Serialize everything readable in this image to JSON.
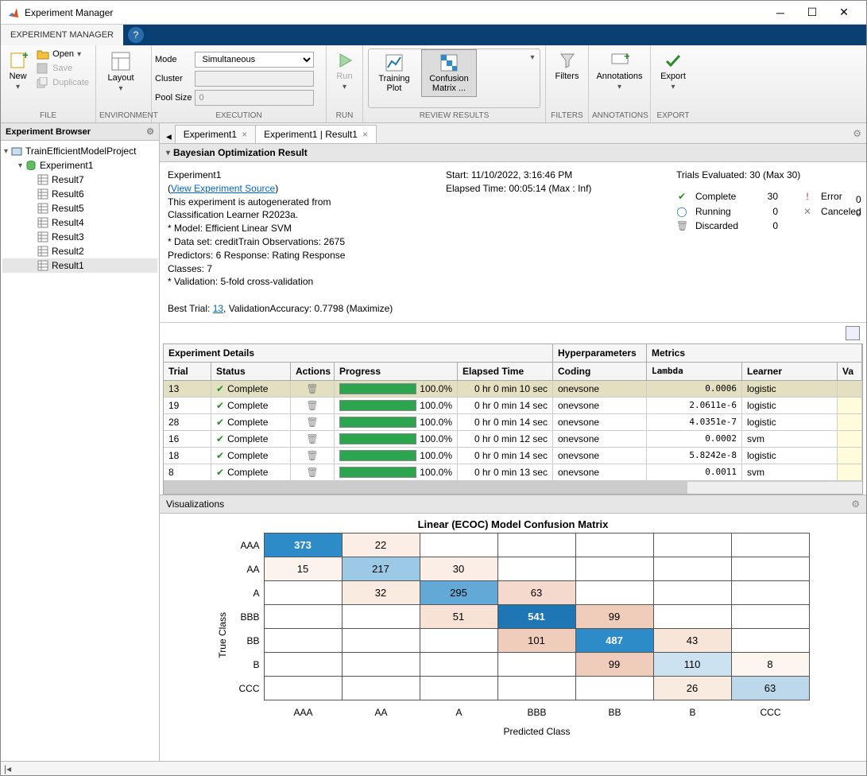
{
  "window": {
    "title": "Experiment Manager"
  },
  "ribbontab": "EXPERIMENT MANAGER",
  "ribbon": {
    "file": {
      "label": "FILE",
      "new": "New",
      "open": "Open",
      "save": "Save",
      "duplicate": "Duplicate"
    },
    "env": {
      "label": "ENVIRONMENT",
      "layout": "Layout"
    },
    "exec": {
      "label": "EXECUTION",
      "mode_l": "Mode",
      "mode_v": "Simultaneous",
      "cluster_l": "Cluster",
      "cluster_v": "",
      "pool_l": "Pool Size",
      "pool_v": "0"
    },
    "run": {
      "label": "RUN",
      "run": "Run"
    },
    "review": {
      "label": "REVIEW RESULTS",
      "training_plot": "Training Plot",
      "confusion_l1": "Confusion",
      "confusion_l2": "Matrix ..."
    },
    "filters": {
      "label": "FILTERS",
      "btn": "Filters"
    },
    "annot": {
      "label": "ANNOTATIONS",
      "btn": "Annotations"
    },
    "export": {
      "label": "EXPORT",
      "btn": "Export"
    }
  },
  "browser": {
    "title": "Experiment Browser",
    "project": "TrainEfficientModelProject",
    "experiment": "Experiment1",
    "results": [
      "Result7",
      "Result6",
      "Result5",
      "Result4",
      "Result3",
      "Result2",
      "Result1"
    ],
    "selected": "Result1"
  },
  "tabs": {
    "t1": "Experiment1",
    "t2": "Experiment1 | Result1"
  },
  "result": {
    "header": "Bayesian Optimization Result",
    "name": "Experiment1",
    "view_source": "View Experiment Source",
    "desc1": "This experiment is autogenerated from",
    "desc2": "Classification Learner R2023a.",
    "model": "* Model: Efficient Linear SVM",
    "dataset": "* Data set: creditTrain   Observations: 2675",
    "predictors": "Predictors: 6   Response: Rating   Response",
    "classes": "Classes: 7",
    "validation": "* Validation: 5-fold cross-validation",
    "best_pre": "Best Trial: ",
    "best_trial": "13",
    "best_post": ", ValidationAccuracy: 0.7798 (Maximize)",
    "start": "Start: 11/10/2022, 3:16:46 PM",
    "elapsed": "Elapsed Time: 00:05:14 (Max : Inf)",
    "trials_eval": "Trials Evaluated: 30 (Max 30)",
    "statuses": {
      "complete_l": "Complete",
      "complete_n": "30",
      "running_l": "Running",
      "running_n": "0",
      "discarded_l": "Discarded",
      "discarded_n": "0",
      "error_l": "Error",
      "error_n": "0",
      "canceled_l": "Canceled",
      "canceled_n": "0"
    }
  },
  "table": {
    "groups": {
      "details": "Experiment Details",
      "hyper": "Hyperparameters",
      "metrics": "Metrics"
    },
    "cols": {
      "trial": "Trial",
      "status": "Status",
      "actions": "Actions",
      "progress": "Progress",
      "elapsed": "Elapsed Time",
      "coding": "Coding",
      "lambda": "Lambda",
      "learner": "Learner",
      "va": "Va"
    },
    "rows": [
      {
        "trial": "13",
        "status": "Complete",
        "progress": "100.0%",
        "elapsed": "0 hr 0 min 10 sec",
        "coding": "onevsone",
        "lambda": "0.0006",
        "learner": "logistic",
        "hl": true
      },
      {
        "trial": "19",
        "status": "Complete",
        "progress": "100.0%",
        "elapsed": "0 hr 0 min 14 sec",
        "coding": "onevsone",
        "lambda": "2.0611e-6",
        "learner": "logistic"
      },
      {
        "trial": "28",
        "status": "Complete",
        "progress": "100.0%",
        "elapsed": "0 hr 0 min 14 sec",
        "coding": "onevsone",
        "lambda": "4.0351e-7",
        "learner": "logistic"
      },
      {
        "trial": "16",
        "status": "Complete",
        "progress": "100.0%",
        "elapsed": "0 hr 0 min 12 sec",
        "coding": "onevsone",
        "lambda": "0.0002",
        "learner": "svm"
      },
      {
        "trial": "18",
        "status": "Complete",
        "progress": "100.0%",
        "elapsed": "0 hr 0 min 14 sec",
        "coding": "onevsone",
        "lambda": "5.8242e-8",
        "learner": "logistic"
      },
      {
        "trial": "8",
        "status": "Complete",
        "progress": "100.0%",
        "elapsed": "0 hr 0 min 13 sec",
        "coding": "onevsone",
        "lambda": "0.0011",
        "learner": "svm"
      }
    ]
  },
  "viz": {
    "title": "Visualizations"
  },
  "chart_data": {
    "type": "heatmap",
    "title": "Linear (ECOC) Model Confusion Matrix",
    "xlabel": "Predicted Class",
    "ylabel": "True Class",
    "categories": [
      "AAA",
      "AA",
      "A",
      "BBB",
      "BB",
      "B",
      "CCC"
    ],
    "matrix": [
      [
        373,
        22,
        null,
        null,
        null,
        null,
        null
      ],
      [
        15,
        217,
        30,
        null,
        null,
        null,
        null
      ],
      [
        null,
        32,
        295,
        63,
        null,
        null,
        null
      ],
      [
        null,
        null,
        51,
        541,
        99,
        null,
        null
      ],
      [
        null,
        null,
        null,
        101,
        487,
        43,
        null
      ],
      [
        null,
        null,
        null,
        null,
        99,
        110,
        8
      ],
      [
        null,
        null,
        null,
        null,
        null,
        26,
        63
      ]
    ],
    "cell_colors": [
      [
        "#2d8bc8",
        "#fbeee6",
        "",
        "",
        "",
        "",
        ""
      ],
      [
        "#fcf3ed",
        "#9cc9e6",
        "#fbeee6",
        "",
        "",
        "",
        ""
      ],
      [
        "",
        "#faebe0",
        "#63a9d8",
        "#f4d9cc",
        "",
        "",
        ""
      ],
      [
        "",
        "",
        "#f7e2d5",
        "#1e77b4",
        "#f0ccba",
        "",
        ""
      ],
      [
        "",
        "",
        "",
        "#f0ccba",
        "#2d8bc8",
        "#f8e5da",
        ""
      ],
      [
        "",
        "",
        "",
        "",
        "#f0ccba",
        "#cde2f0",
        "#fdf5f0"
      ],
      [
        "",
        "",
        "",
        "",
        "",
        "#faebe0",
        "#bcd8ea"
      ]
    ],
    "cell_text_white": [
      [
        true,
        false
      ],
      [
        false,
        false,
        false
      ],
      [
        false,
        false,
        false,
        false
      ],
      [
        false,
        false,
        false,
        true,
        false
      ],
      [
        false,
        false,
        false,
        false,
        true,
        false
      ],
      [
        false,
        false,
        false,
        false,
        false,
        false,
        false
      ],
      [
        false,
        false,
        false,
        false,
        false,
        false,
        false
      ]
    ]
  }
}
